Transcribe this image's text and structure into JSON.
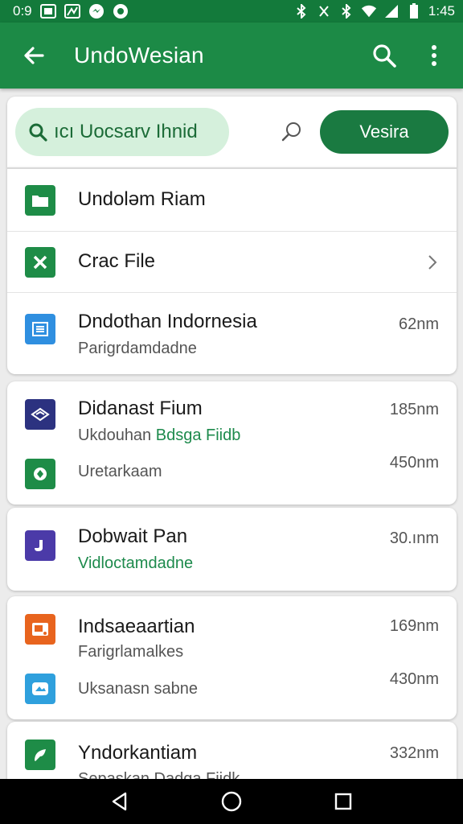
{
  "status_bar": {
    "time": "0:9",
    "clock": "1:45"
  },
  "app_bar": {
    "title": "UndoWesian"
  },
  "search": {
    "query": "ıcı Uocsarv Ihnid",
    "button_label": "Vesira"
  },
  "list": [
    {
      "title": "Undoləm Riam",
      "icon": "folder-icon",
      "icon_color": "#1e8c47"
    },
    {
      "title": "Crac File",
      "icon": "excel-icon",
      "icon_color": "#1e8c47"
    },
    {
      "title": "Dndothan Indornesia",
      "subtitle": "Parigrdamdadne",
      "meta": "62nm",
      "icon": "doc-icon",
      "icon_color": "#2f8fe0"
    }
  ],
  "cards": [
    {
      "title": "Didanast Fium",
      "subtitle_a": "Ukdouhan",
      "subtitle_b": "Bdsga Fiidb",
      "meta": "185nm",
      "icon": "drive-icon",
      "icon_color": "#2c3280",
      "row2_title": "Uretarkaam",
      "row2_meta": "450nm",
      "row2_icon": "map-pin-icon",
      "row2_icon_color": "#1e8c47"
    },
    {
      "title": "Dobwait Pan",
      "subtitle": "Vidloctamdadne",
      "meta": "30.ınm",
      "icon": "note-icon",
      "icon_color": "#4b3aa8"
    },
    {
      "title": "Indsaeaartian",
      "subtitle": "Farigrlamalkes",
      "meta": "169nm",
      "icon": "slides-icon",
      "icon_color": "#e8641e",
      "row2_title": "Uksanasn sabne",
      "row2_meta": "430nm",
      "row2_icon": "photo-icon",
      "row2_icon_color": "#2fa0dd"
    },
    {
      "title": "Yndorkantiam",
      "subtitle": "Sepaskan Dadga Fiidk",
      "meta": "332nm",
      "icon": "leaf-icon",
      "icon_color": "#1e8c47"
    }
  ]
}
